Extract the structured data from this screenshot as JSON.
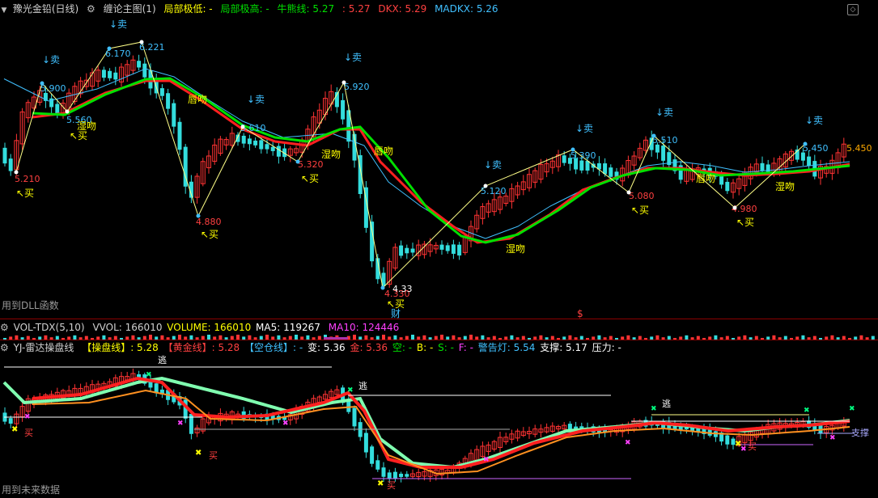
{
  "main": {
    "title": "豫光金铅(日线)",
    "indicator": "缠论主图(1)",
    "local_low_label": "局部极低: -",
    "local_high_label": "局部极高: -",
    "bull_label": "牛熊线: 5.27",
    "bull_val2": ": 5.27",
    "dkx_label": "DKX: 5.29",
    "madkx_label": "MADKX: 5.26",
    "footnote": "用到DLL函数",
    "colors": {
      "title": "#c8c8c8",
      "green": "#00e000",
      "yellow": "#ffff00",
      "red": "#ff4040",
      "cyan": "#40c0ff",
      "up": "#ff3333",
      "down": "#33dddd"
    },
    "price_labels": [
      "5.210",
      "5.900",
      "5.560",
      "6.170",
      "6.221",
      "4.880",
      "5.610",
      "5.320",
      "5.920",
      "4.330",
      "4.33",
      "5.120",
      "5.390",
      "5.080",
      "5.510",
      "4.980",
      "5.450",
      "5.450"
    ],
    "signals": {
      "sell": "↓卖",
      "buy": "↖买",
      "buy2": "↖ 买",
      "lip_kiss": "唇吻",
      "wet_kiss": "湿吻",
      "cai": "财",
      "dollar": "$"
    }
  },
  "vol": {
    "title": "VOL-TDX(5,10)",
    "vvol": "VVOL: 166010",
    "volume": "VOLUME: 166010",
    "ma5": "MA5: 119267",
    "ma10": "MA10: 124446"
  },
  "radar": {
    "title": "YJ-雷达操盘线",
    "caopan": "【操盘线】: 5.28",
    "huangjin": "【黄金线】: 5.28",
    "kongcang": "【空仓线】: -",
    "bian": "变: 5.36",
    "jin": "金: 5.36",
    "kong": "空: -",
    "b": "B: -",
    "s": "S: -",
    "f": "F: -",
    "jinggao": "警告灯: 5.54",
    "zhicheng": "支撑: 5.17",
    "yali": "压力: -",
    "escape": "逃",
    "buy": "买",
    "support_label": "支撑",
    "footnote": "用到未来数据"
  }
}
